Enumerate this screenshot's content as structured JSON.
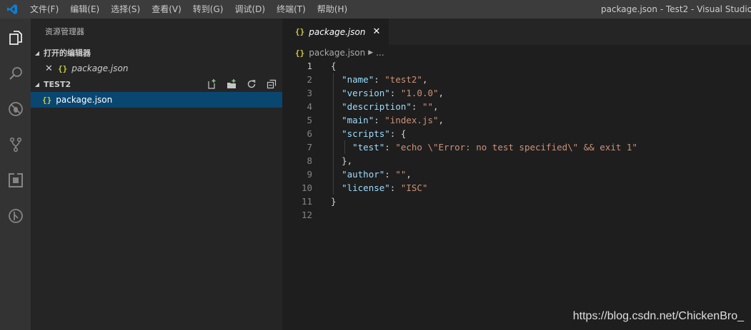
{
  "titlebar": {
    "menu": [
      "文件(F)",
      "编辑(E)",
      "选择(S)",
      "查看(V)",
      "转到(G)",
      "调试(D)",
      "终端(T)",
      "帮助(H)"
    ],
    "window_title": "package.json - Test2 - Visual Studio Code"
  },
  "activity": [
    "explorer-icon",
    "search-icon",
    "debug-icon",
    "source-control-icon",
    "extensions-icon",
    "remote-icon"
  ],
  "sidebar": {
    "title": "资源管理器",
    "open_editors": {
      "header": "打开的编辑器",
      "items": [
        {
          "name": "package.json",
          "icon": "{}"
        }
      ]
    },
    "folder": {
      "header": "TEST2",
      "files": [
        {
          "name": "package.json",
          "icon": "{}"
        }
      ]
    }
  },
  "editor": {
    "tab": {
      "label": "package.json",
      "icon": "{}"
    },
    "breadcrumb": {
      "file": "package.json",
      "more": "..."
    },
    "lines": [
      {
        "n": "1",
        "text": "{"
      },
      {
        "n": "2",
        "key": "\"name\"",
        "val": "\"test2\"",
        "end": ","
      },
      {
        "n": "3",
        "key": "\"version\"",
        "val": "\"1.0.0\"",
        "end": ","
      },
      {
        "n": "4",
        "key": "\"description\"",
        "val": "\"\"",
        "end": ","
      },
      {
        "n": "5",
        "key": "\"main\"",
        "val": "\"index.js\"",
        "end": ","
      },
      {
        "n": "6",
        "key": "\"scripts\"",
        "val": "",
        "end": "{"
      },
      {
        "n": "7",
        "key": "\"test\"",
        "val": "\"echo \\\"Error: no test specified\\\" && exit 1\"",
        "end": ""
      },
      {
        "n": "8",
        "text": "},"
      },
      {
        "n": "9",
        "key": "\"author\"",
        "val": "\"\"",
        "end": ","
      },
      {
        "n": "10",
        "key": "\"license\"",
        "val": "\"ISC\"",
        "end": ""
      },
      {
        "n": "11",
        "text": "}"
      },
      {
        "n": "12",
        "text": ""
      }
    ]
  },
  "watermark": "https://blog.csdn.net/ChickenBro_",
  "colors": {
    "accent": "#094771",
    "string": "#ce9178",
    "key": "#9cdcfe",
    "json_icon": "#cbcb41"
  }
}
